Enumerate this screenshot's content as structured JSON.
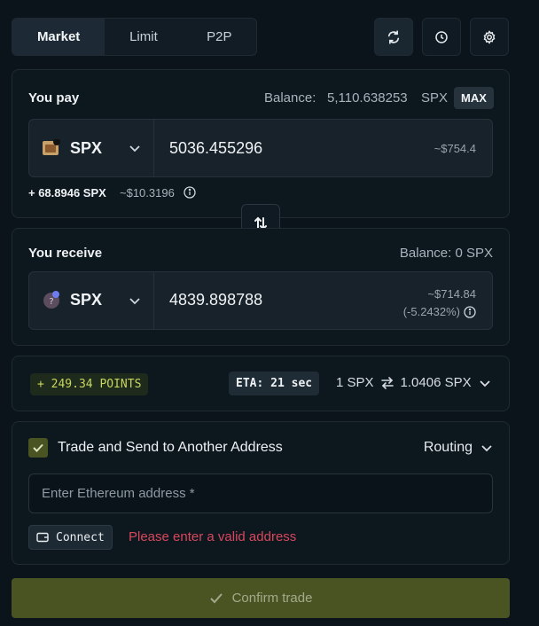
{
  "tabs": [
    "Market",
    "Limit",
    "P2P"
  ],
  "active_tab": "Market",
  "pay": {
    "label": "You pay",
    "balance_label": "Balance:",
    "balance_value": "5,110.638253",
    "balance_unit": "SPX",
    "max_label": "MAX",
    "token": "SPX",
    "amount": "5036.455296",
    "usd": "~$754.4",
    "extra_amount": "+ 68.8946 SPX",
    "extra_usd": "~$10.3196"
  },
  "receive": {
    "label": "You receive",
    "balance": "Balance: 0 SPX",
    "token": "SPX",
    "amount": "4839.898788",
    "usd": "~$714.84",
    "usd_change": "(-5.2432%)"
  },
  "info": {
    "points": "+ 249.34 POINTS",
    "eta": "ETA: 21 sec",
    "rate_from": "1 SPX",
    "rate_to": "1.0406 SPX"
  },
  "send": {
    "checkbox_label": "Trade and Send to Another Address",
    "routing_label": "Routing",
    "address_placeholder": "Enter Ethereum address *",
    "connect_label": "Connect",
    "error": "Please enter a valid address"
  },
  "confirm_label": "Confirm trade",
  "colors": {
    "background": "#0b141b",
    "accent_olive": "#4a5423",
    "points_text": "#c9d65d",
    "error": "#d9475d"
  }
}
